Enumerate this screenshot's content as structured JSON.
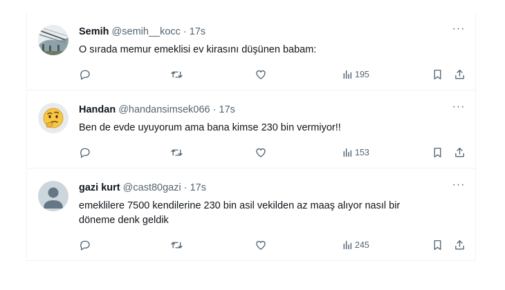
{
  "tweets": [
    {
      "name": "Semih",
      "handle": "@semih__kocc",
      "separator": "·",
      "time": "17s",
      "text": "O sırada memur emeklisi ev kirasını düşünen babam:",
      "views": "195",
      "avatar_icon": "photo-avatar"
    },
    {
      "name": "Handan",
      "handle": "@handansimsek066",
      "separator": "·",
      "time": "17s",
      "text": "Ben de evde uyuyorum ama bana kimse 230 bin vermiyor!!",
      "views": "153",
      "avatar_icon": "thinking-face-emoji"
    },
    {
      "name": "gazi kurt",
      "handle": "@cast80gazi",
      "separator": "·",
      "time": "17s",
      "text": "emeklilere 7500 kendilerine 230 bin asil vekilden az maaş alıyor nasıl bir döneme denk geldik",
      "views": "245",
      "avatar_icon": "default-profile-icon"
    }
  ],
  "more_label": "···",
  "colors": {
    "text": "#0f1419",
    "secondary": "#536471",
    "divider": "#eff3f4"
  }
}
